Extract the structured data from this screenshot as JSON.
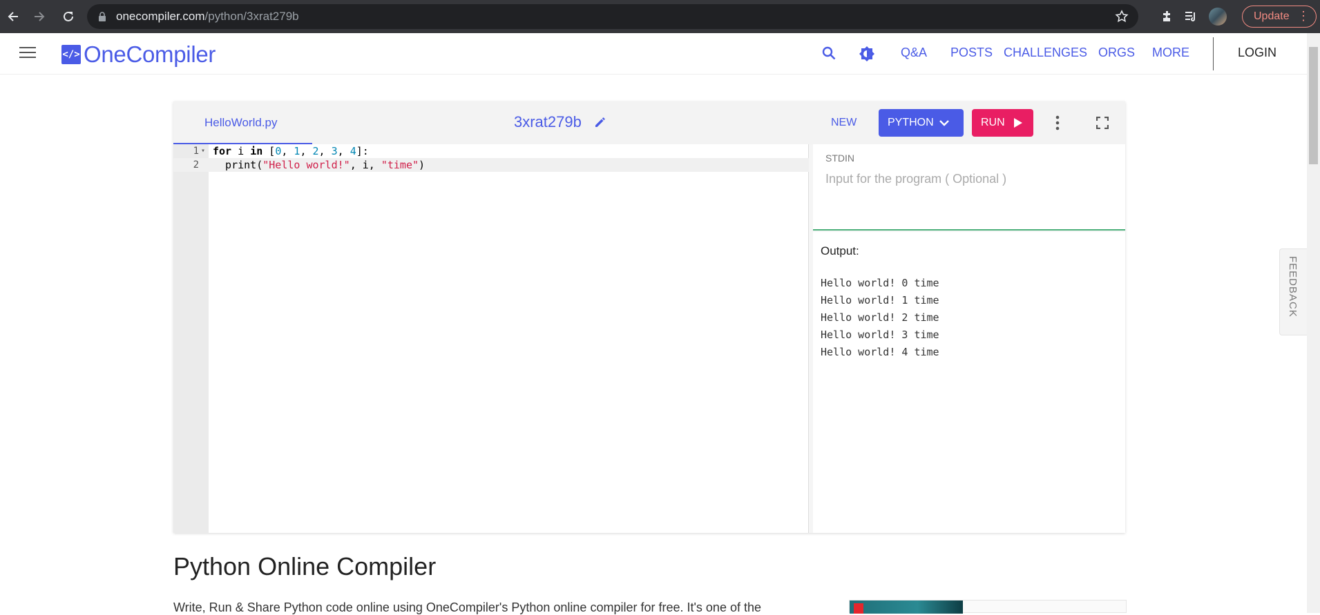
{
  "browser": {
    "url_host": "onecompiler.com",
    "url_path": "/python/3xrat279b",
    "update_label": "Update"
  },
  "header": {
    "logo_mark": "</>",
    "logo_text": "OneCompiler",
    "nav": [
      "Q&A",
      "POSTS",
      "CHALLENGES",
      "ORGS",
      "MORE"
    ],
    "login_label": "LOGIN"
  },
  "editor": {
    "file_name": "HelloWorld.py",
    "code_id": "3xrat279b",
    "new_label": "NEW",
    "language_label": "PYTHON",
    "run_label": "RUN",
    "code_lines": [
      {
        "num": "1"
      },
      {
        "num": "2"
      }
    ],
    "stdin_label": "STDIN",
    "stdin_placeholder": "Input for the program ( Optional )",
    "output_label": "Output:",
    "output_lines": [
      "Hello world! 0 time",
      "Hello world! 1 time",
      "Hello world! 2 time",
      "Hello world! 3 time",
      "Hello world! 4 time"
    ]
  },
  "page": {
    "heading": "Python Online Compiler",
    "intro": "Write, Run & Share Python code online using OneCompiler's Python online compiler for free. It's one of the"
  },
  "feedback_label": "FEEDBACK",
  "colors": {
    "brand": "#4a5be6",
    "run": "#e91e63",
    "stdin_divider": "#4caf7a"
  }
}
